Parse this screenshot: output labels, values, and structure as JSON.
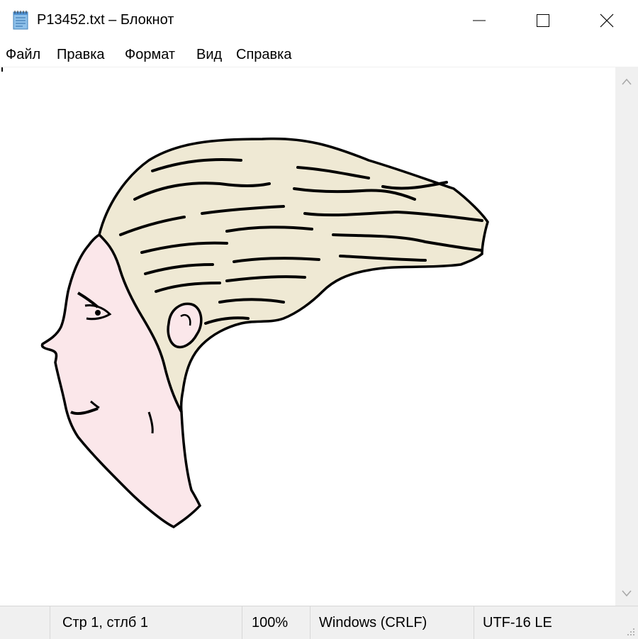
{
  "window": {
    "title": "P13452.txt – Блокнот",
    "icons": {
      "app": "notepad-icon",
      "minimize": "minimize-icon",
      "maximize": "maximize-icon",
      "close": "close-icon"
    }
  },
  "menu": {
    "items": [
      "Файл",
      "Правка",
      "Формат",
      "Вид",
      "Справка"
    ]
  },
  "document": {
    "content_description_icon": "ascii-art-drawing",
    "colors": {
      "hair": "#efe9d4",
      "skin": "#fbe7ea",
      "ink": "#000000"
    }
  },
  "scrollbar": {
    "up_icon": "chevron-up-icon",
    "down_icon": "chevron-down-icon"
  },
  "status": {
    "position": "Стр 1, стлб 1",
    "zoom": "100%",
    "line_endings": "Windows (CRLF)",
    "encoding": "UTF-16 LE"
  }
}
